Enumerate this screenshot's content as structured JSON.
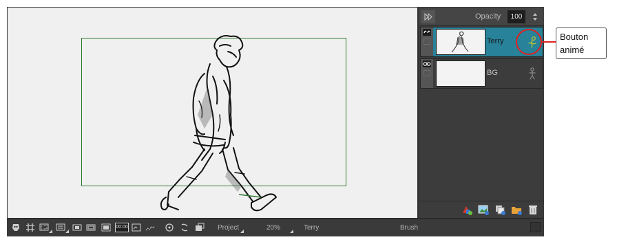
{
  "panel": {
    "opacity_label": "Opacity",
    "opacity_value": "100",
    "layers": [
      {
        "name": "Terry",
        "selected": true
      },
      {
        "name": "BG",
        "selected": false
      }
    ]
  },
  "toolbar": {
    "project_label": "Project",
    "zoom_label": "20%",
    "layer_label": "Terry",
    "tool_label": "Brush",
    "timecode_label": "00:00"
  },
  "callout": {
    "line1": "Bouton",
    "line2": "animé"
  },
  "colors": {
    "selected_layer": "#27829a",
    "camera_frame": "#2d7a2d",
    "animate_button_active": "#b5c23a",
    "callout": "#e02020"
  },
  "icons": {
    "panel_bottom": [
      "add-drawing-layer-icon",
      "add-image-layer-icon",
      "duplicate-layer-icon",
      "add-group-icon",
      "delete-layer-icon"
    ]
  }
}
